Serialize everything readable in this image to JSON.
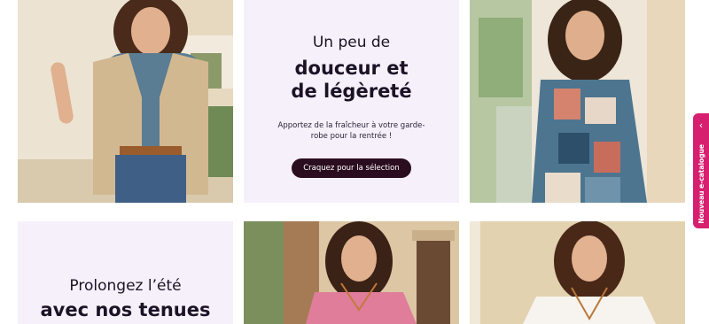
{
  "promo_top": {
    "light": "Un peu de",
    "bold_line1": "douceur et",
    "bold_line2": "de légèreté",
    "description": "Apportez de la fraîcheur à votre garde-robe pour la rentrée !",
    "cta_label": "Craquez pour la sélection"
  },
  "promo_bottom": {
    "light": "Prolongez l’été",
    "bold_line1": "avec nos tenues"
  },
  "side_tab": {
    "label": "Nouveau e-catalogue",
    "icon": "chevron-left-icon"
  },
  "colors": {
    "accent": "#d6206f",
    "promo_background": "#f6f0fb",
    "cta_background": "#2a0d1f"
  },
  "images": [
    {
      "name": "model-beige-cardigan-photo"
    },
    {
      "name": "model-patchwork-blouse-photo"
    },
    {
      "name": "model-pink-sweater-photo"
    },
    {
      "name": "model-white-top-photo"
    }
  ]
}
